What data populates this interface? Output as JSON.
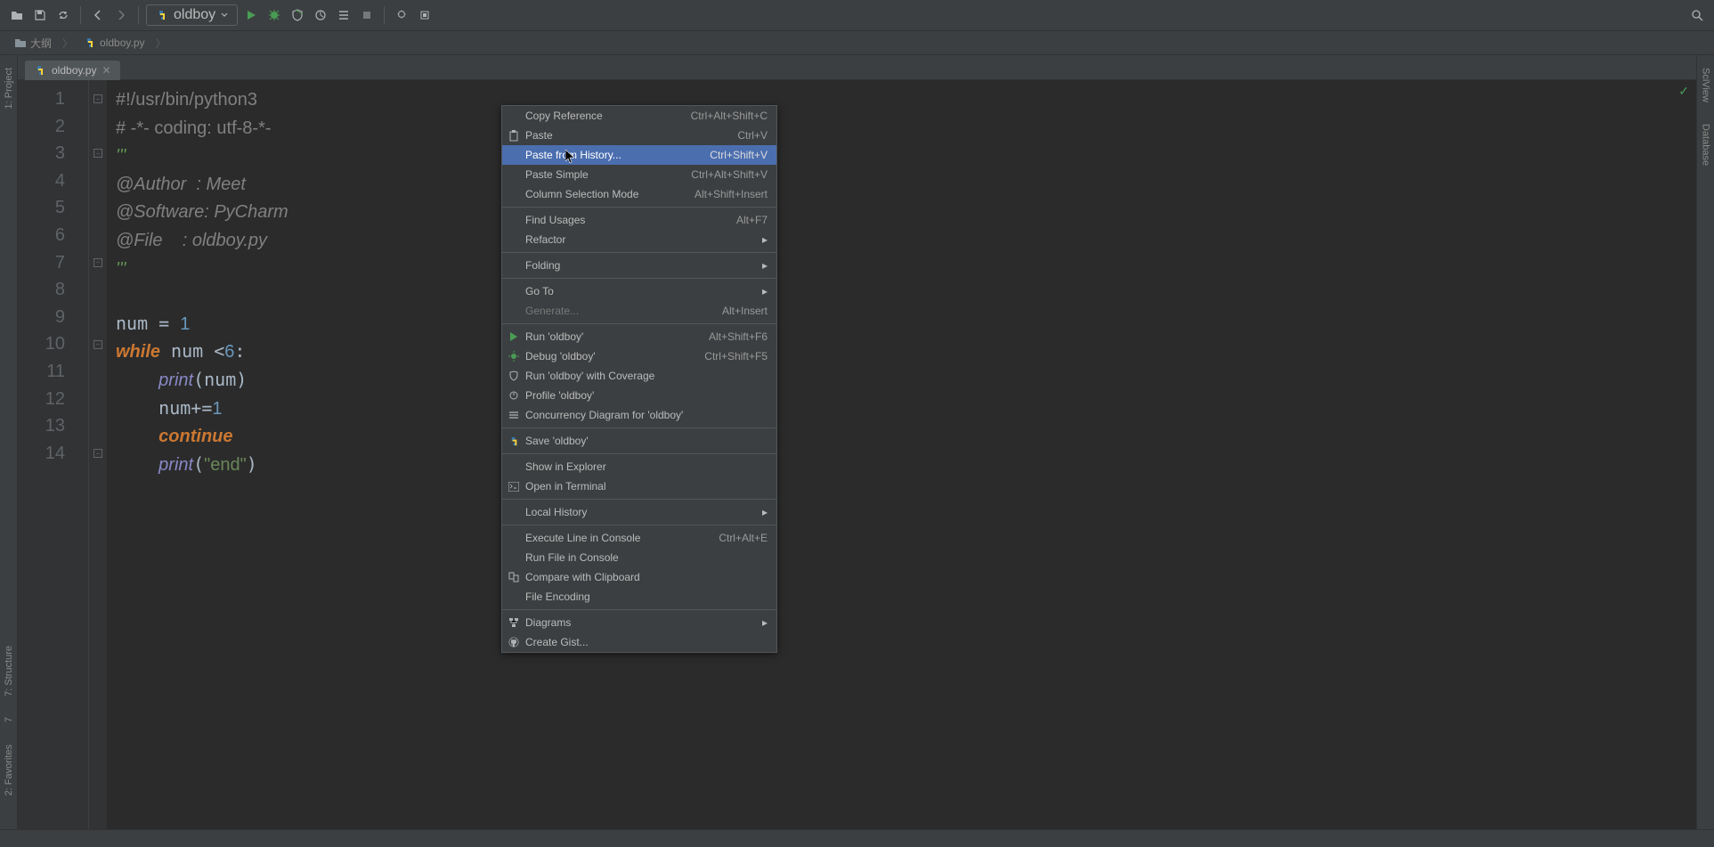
{
  "runConfig": {
    "name": "oldboy"
  },
  "breadcrumbs": [
    {
      "icon": "folder",
      "label": "大纲"
    },
    {
      "icon": "py",
      "label": "oldboy.py"
    }
  ],
  "leftPanels": [
    {
      "label": "1: Project"
    },
    {
      "label": "7: Structure"
    },
    {
      "label": "7"
    },
    {
      "label": "2: Favorites"
    }
  ],
  "rightPanels": [
    {
      "label": "SciView"
    },
    {
      "label": "Database"
    }
  ],
  "tab": {
    "label": "oldboy.py"
  },
  "gutterLines": [
    "1",
    "2",
    "3",
    "4",
    "5",
    "6",
    "7",
    "8",
    "9",
    "10",
    "11",
    "12",
    "13",
    "14"
  ],
  "code": {
    "l1": {
      "type": "comment",
      "text": "#!/usr/bin/python3"
    },
    "l2": {
      "type": "comment",
      "text": "# -*- coding: utf-8-*-"
    },
    "l3": {
      "type": "docstr",
      "text": "'''"
    },
    "l4": {
      "type": "docline",
      "text": "@Author  : Meet"
    },
    "l5": {
      "type": "docline",
      "text": "@Software: PyCharm"
    },
    "l6": {
      "type": "docline",
      "text": "@File    : oldboy.py"
    },
    "l7": {
      "type": "docstr",
      "text": "'''"
    },
    "l8": {
      "type": "blank",
      "text": " "
    },
    "l9": {
      "pre": "num = ",
      "num": "1"
    },
    "l10": {
      "kw": "while",
      "mid": " num <",
      "num": "6",
      "post": ":"
    },
    "l11": {
      "indent": "    ",
      "fn": "print",
      "args": "(num)"
    },
    "l12": {
      "indent": "    ",
      "pre": "num+=",
      "num": "1"
    },
    "l13": {
      "indent": "    ",
      "kw": "continue"
    },
    "l14": {
      "indent": "    ",
      "fn": "print",
      "open": "(",
      "str": "\"end\"",
      "close": ")"
    }
  },
  "contextMenu": {
    "items": [
      {
        "label": "Copy Reference",
        "shortcut": "Ctrl+Alt+Shift+C",
        "icon": ""
      },
      {
        "label": "Paste",
        "shortcut": "Ctrl+V",
        "icon": "paste",
        "mnemonic": "P"
      },
      {
        "label": "Paste from History...",
        "shortcut": "Ctrl+Shift+V",
        "selected": true,
        "mnemonic": "o"
      },
      {
        "label": "Paste Simple",
        "shortcut": "Ctrl+Alt+Shift+V",
        "mnemonic": "i"
      },
      {
        "label": "Column Selection Mode",
        "shortcut": "Alt+Shift+Insert",
        "mnemonic": "M"
      },
      {
        "type": "sep"
      },
      {
        "label": "Find Usages",
        "shortcut": "Alt+F7",
        "mnemonic": "U"
      },
      {
        "label": "Refactor",
        "arrow": true,
        "mnemonic": "R"
      },
      {
        "type": "sep"
      },
      {
        "label": "Folding",
        "arrow": true
      },
      {
        "type": "sep"
      },
      {
        "label": "Go To",
        "arrow": true
      },
      {
        "label": "Generate...",
        "shortcut": "Alt+Insert",
        "disabled": true
      },
      {
        "type": "sep"
      },
      {
        "label": "Run 'oldboy'",
        "shortcut": "Alt+Shift+F6",
        "icon": "run",
        "mnemonic": "u"
      },
      {
        "label": "Debug 'oldboy'",
        "shortcut": "Ctrl+Shift+F5",
        "icon": "debug",
        "mnemonic": "D"
      },
      {
        "label": "Run 'oldboy' with Coverage",
        "icon": "coverage",
        "mnemonic": "o"
      },
      {
        "label": "Profile 'oldboy'",
        "icon": "profile"
      },
      {
        "label": "Concurrency Diagram for 'oldboy'",
        "icon": "concurrency"
      },
      {
        "type": "sep"
      },
      {
        "label": "Save 'oldboy'",
        "icon": "python"
      },
      {
        "type": "sep"
      },
      {
        "label": "Show in Explorer"
      },
      {
        "label": "Open in Terminal",
        "icon": "terminal"
      },
      {
        "type": "sep"
      },
      {
        "label": "Local History",
        "arrow": true,
        "mnemonic": "H"
      },
      {
        "type": "sep"
      },
      {
        "label": "Execute Line in Console",
        "shortcut": "Ctrl+Alt+E"
      },
      {
        "label": "Run File in Console",
        "mnemonic": "o"
      },
      {
        "label": "Compare with Clipboard",
        "icon": "compare",
        "mnemonic": "b"
      },
      {
        "label": "File Encoding"
      },
      {
        "type": "sep"
      },
      {
        "label": "Diagrams",
        "arrow": true,
        "icon": "diagrams",
        "mnemonic": "D"
      },
      {
        "label": "Create Gist...",
        "icon": "github"
      }
    ]
  }
}
